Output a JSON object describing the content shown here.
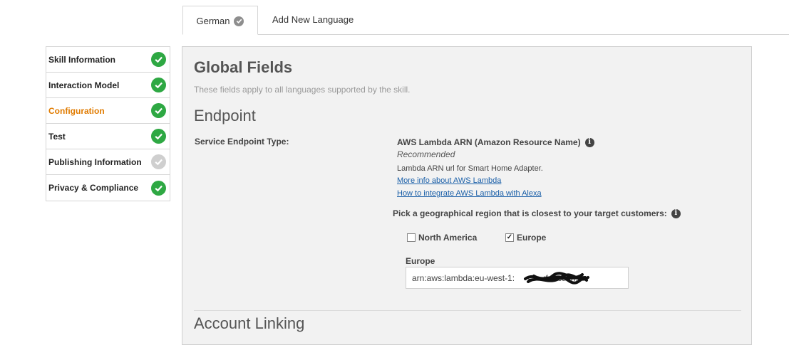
{
  "tabs": {
    "active_label": "German",
    "add_label": "Add New Language"
  },
  "sidebar": {
    "items": [
      {
        "label": "Skill Information",
        "status": "complete"
      },
      {
        "label": "Interaction Model",
        "status": "complete"
      },
      {
        "label": "Configuration",
        "status": "complete",
        "active": true
      },
      {
        "label": "Test",
        "status": "complete"
      },
      {
        "label": "Publishing Information",
        "status": "pending"
      },
      {
        "label": "Privacy & Compliance",
        "status": "complete"
      }
    ]
  },
  "main": {
    "title": "Global Fields",
    "subtitle": "These fields apply to all languages supported by the skill.",
    "endpoint": {
      "heading": "Endpoint",
      "type_label": "Service Endpoint Type:",
      "arn_title": "AWS Lambda ARN (Amazon Resource Name)",
      "recommended": "Recommended",
      "description": "Lambda ARN url for Smart Home Adapter.",
      "link_more_info": "More info about AWS Lambda",
      "link_integrate": "How to integrate AWS Lambda with Alexa",
      "region_prompt": "Pick a geographical region that is closest to your target customers:",
      "regions": [
        {
          "label": "North America",
          "checked": false
        },
        {
          "label": "Europe",
          "checked": true
        }
      ],
      "europe_field_label": "Europe",
      "europe_field_value": "arn:aws:lambda:eu-west-1:            :function:i"
    },
    "account_linking_heading": "Account Linking"
  },
  "colors": {
    "active_nav": "#e07b00",
    "complete_check": "#2ea843",
    "pending_check": "#cfcfcf",
    "link": "#1a5fa8"
  }
}
